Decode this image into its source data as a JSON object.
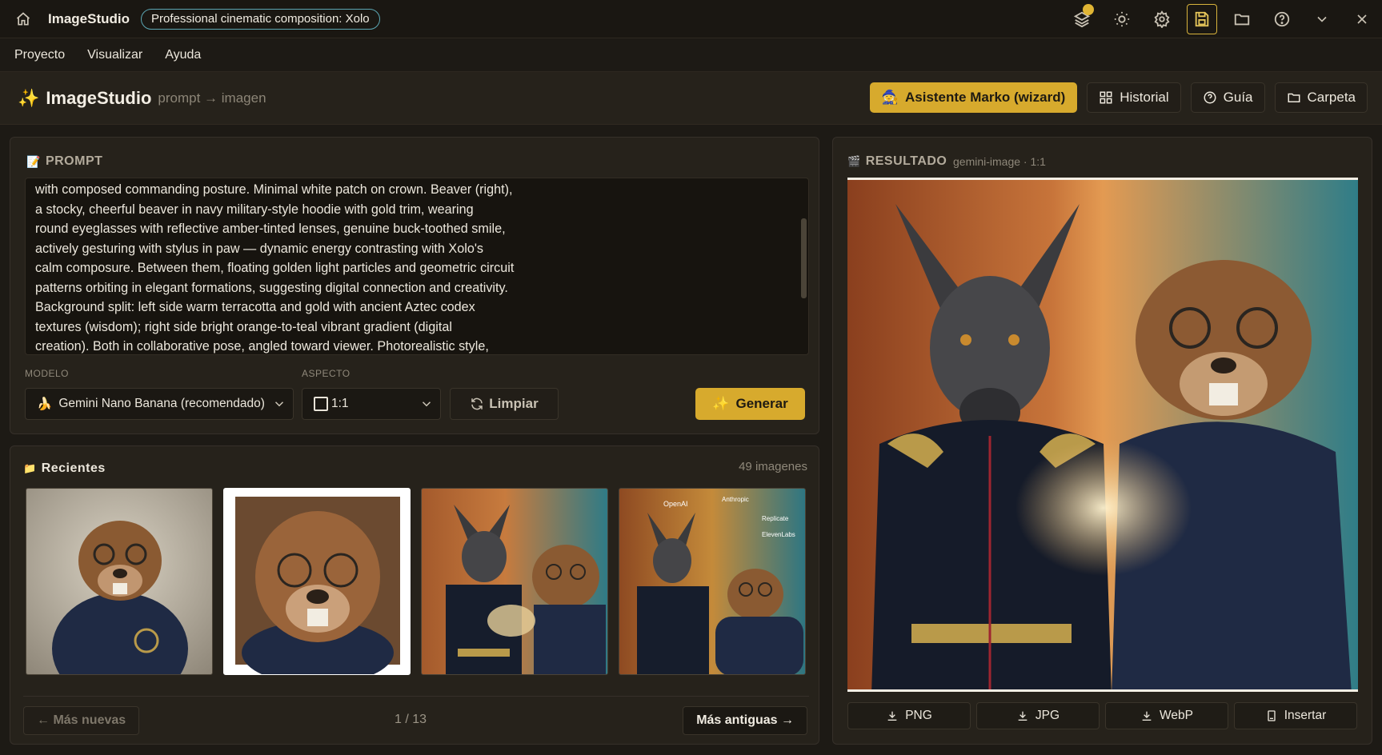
{
  "titlebar": {
    "app_name": "ImageStudio",
    "document_title": "Professional cinematic composition: Xolo",
    "icons": [
      "home-icon",
      "layers-icon",
      "sun-icon",
      "gear-icon",
      "save-icon",
      "folder-icon",
      "help-icon",
      "chevron-down-icon",
      "close-icon"
    ]
  },
  "menubar": {
    "items": [
      "Proyecto",
      "Visualizar",
      "Ayuda"
    ]
  },
  "header": {
    "title": "ImageStudio",
    "subtitle": "prompt → imagen",
    "wizard_label": "Asistente Marko (wizard)",
    "history_label": "Historial",
    "guide_label": "Guía",
    "folder_label": "Carpeta"
  },
  "prompt_panel": {
    "title": "PROMPT",
    "text": "with composed commanding posture. Minimal white patch on crown. Beaver (right),\na stocky, cheerful beaver in navy military-style hoodie with gold trim, wearing\nround eyeglasses with reflective amber-tinted lenses, genuine buck-toothed smile,\nactively gesturing with stylus in paw — dynamic energy contrasting with Xolo's\ncalm composure. Between them, floating golden light particles and geometric circuit\npatterns orbiting in elegant formations, suggesting digital connection and creativity.\nBackground split: left side warm terracotta and gold with ancient Aztec codex\ntextures (wisdom); right side bright orange-to-teal vibrant gradient (digital\ncreation). Both in collaborative pose, angled toward viewer. Photorealistic style,",
    "model_label": "MODELO",
    "model_value": "Gemini Nano Banana (recomendado)",
    "aspect_label": "ASPECTO",
    "aspect_value": "1:1",
    "clear_label": "Limpiar",
    "generate_label": "Generar"
  },
  "recent_panel": {
    "title": "Recientes",
    "count": "49 imagenes",
    "thumbnails": [
      "beaver-hoodie",
      "beaver-portrait",
      "xolo-and-beaver",
      "xolo-beaver-logos"
    ],
    "logo_texts": [
      "OpenAI",
      "Anthropic",
      "Replicate",
      "ElevenLabs"
    ],
    "prev_label": "← Más nuevas",
    "page_indicator": "1 / 13",
    "next_label": "Más antiguas →"
  },
  "result_panel": {
    "title": "RESULTADO",
    "meta": "gemini-image · 1:1",
    "download_png": "PNG",
    "download_jpg": "JPG",
    "download_webp": "WebP",
    "insert_label": "Insertar"
  },
  "colors": {
    "accent": "#d7aa2d",
    "bg": "#1d1a15",
    "panel": "#26221b",
    "pill_border": "#5ba6b3"
  }
}
